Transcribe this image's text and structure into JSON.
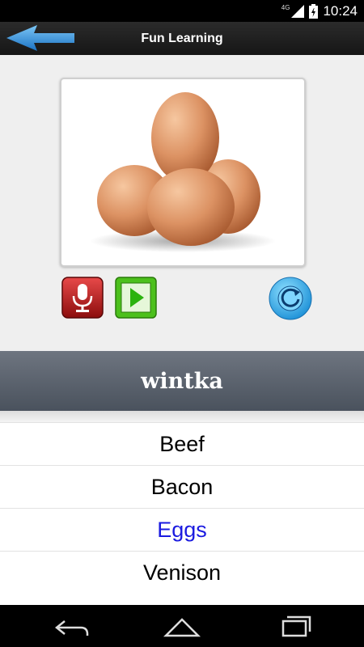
{
  "status_bar": {
    "network": "4G",
    "time": "10:24"
  },
  "app": {
    "title": "Fun Learning",
    "back_icon": "arrow-left-icon"
  },
  "image": {
    "subject": "eggs"
  },
  "controls": {
    "mic_icon": "microphone-icon",
    "play_icon": "play-icon",
    "refresh_icon": "refresh-icon"
  },
  "word": "wintka",
  "options": [
    {
      "label": "Beef",
      "selected": false
    },
    {
      "label": "Bacon",
      "selected": false
    },
    {
      "label": "Eggs",
      "selected": true
    },
    {
      "label": "Venison",
      "selected": false
    }
  ],
  "colors": {
    "selected_option": "#1a1ae0",
    "banner": "#5a616b",
    "back_arrow": "#2a8fd8"
  },
  "nav": {
    "back_icon": "nav-back-icon",
    "home_icon": "nav-home-icon",
    "recents_icon": "nav-recents-icon"
  }
}
